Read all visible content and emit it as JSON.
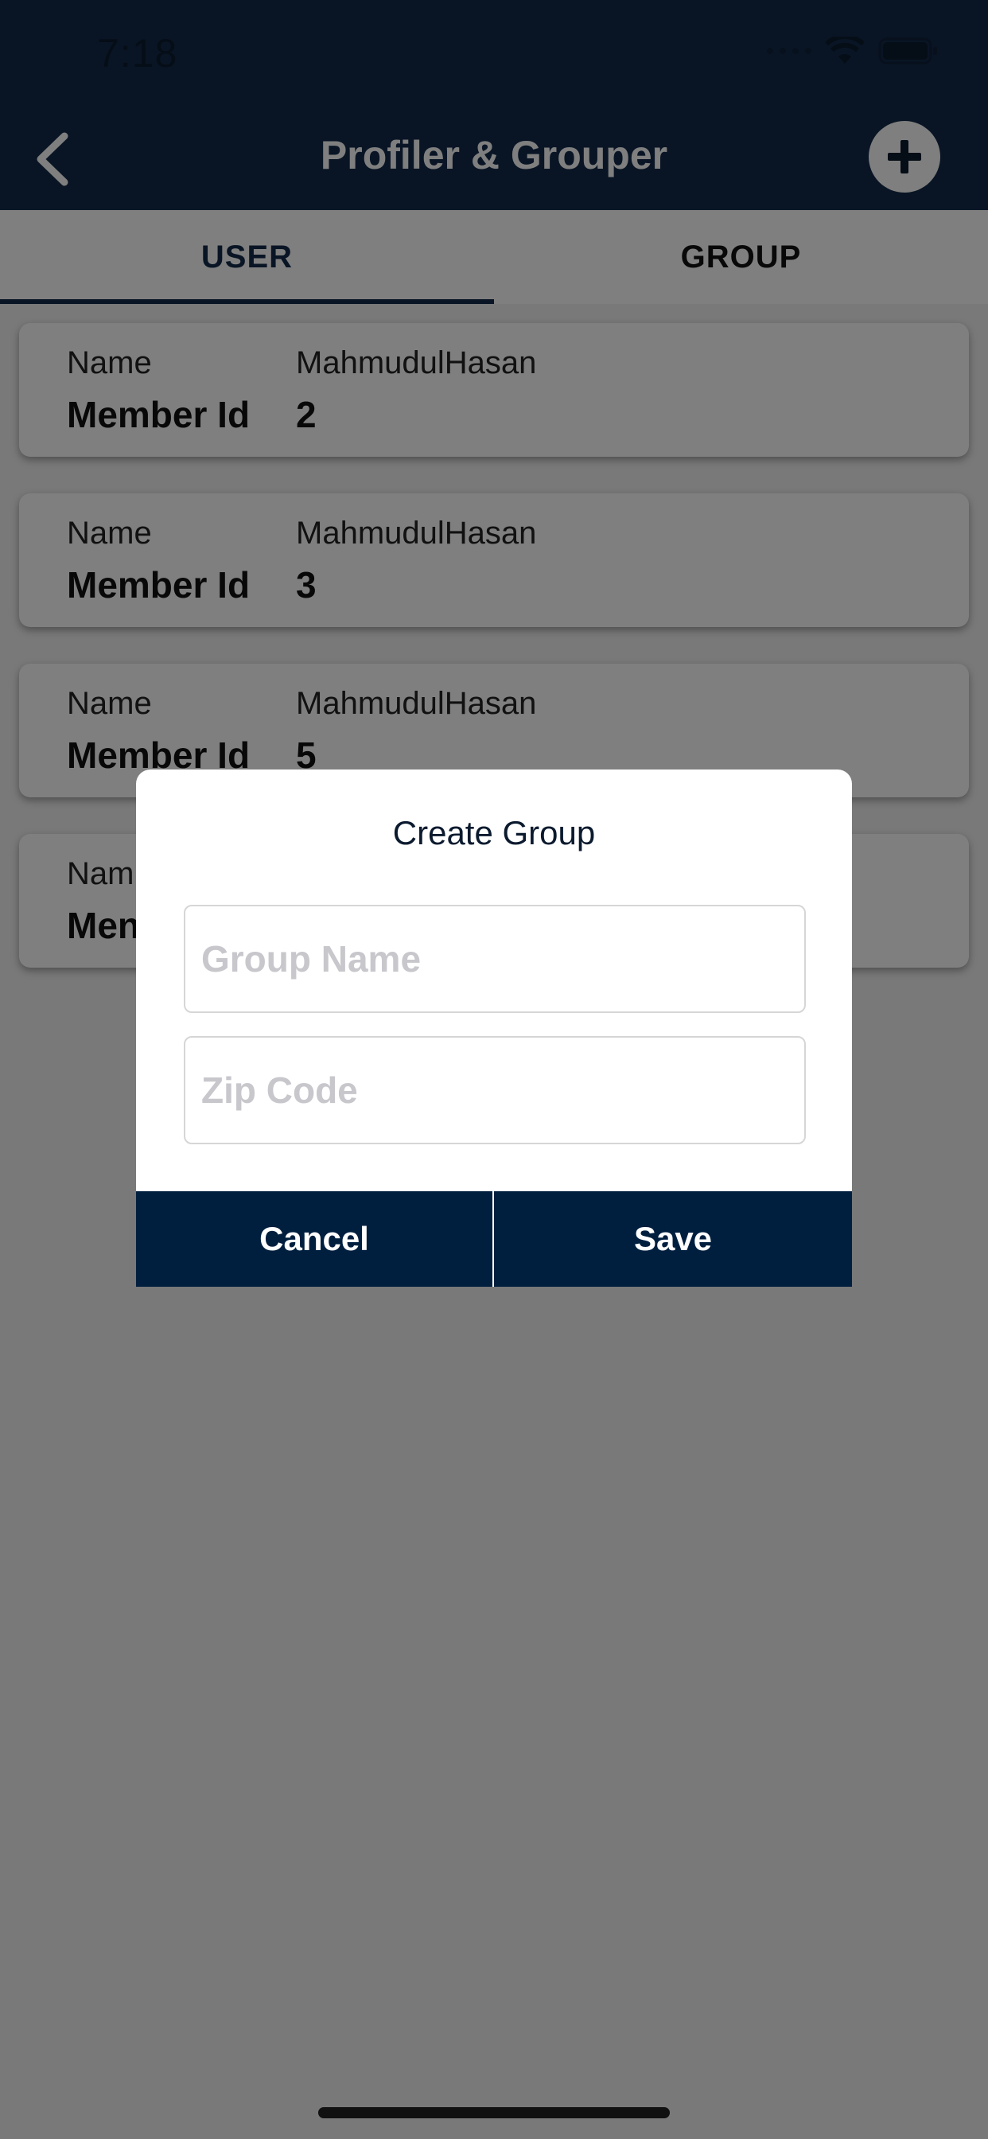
{
  "status_bar": {
    "time": "7:18"
  },
  "header": {
    "title": "Profiler & Grouper",
    "back_icon": "chevron-left-icon",
    "add_icon": "plus-circle-icon"
  },
  "tabs": [
    {
      "label": "USER",
      "active": true
    },
    {
      "label": "GROUP",
      "active": false
    }
  ],
  "members": [
    {
      "name_label": "Name",
      "name_value": "MahmudulHasan",
      "id_label": "Member Id",
      "id_value": "2"
    },
    {
      "name_label": "Name",
      "name_value": "MahmudulHasan",
      "id_label": "Member Id",
      "id_value": "3"
    },
    {
      "name_label": "Name",
      "name_value": "MahmudulHasan",
      "id_label": "Member Id",
      "id_value": "5"
    },
    {
      "name_label": "Nam",
      "name_value": "",
      "id_label": "Men",
      "id_value": ""
    }
  ],
  "dialog": {
    "title": "Create Group",
    "group_name_placeholder": "Group Name",
    "zip_code_placeholder": "Zip Code",
    "cancel_label": "Cancel",
    "save_label": "Save"
  },
  "colors": {
    "header": "#132b4a",
    "dialog_button": "#001f3f",
    "overlay": "rgba(0,0,0,0.5)"
  }
}
